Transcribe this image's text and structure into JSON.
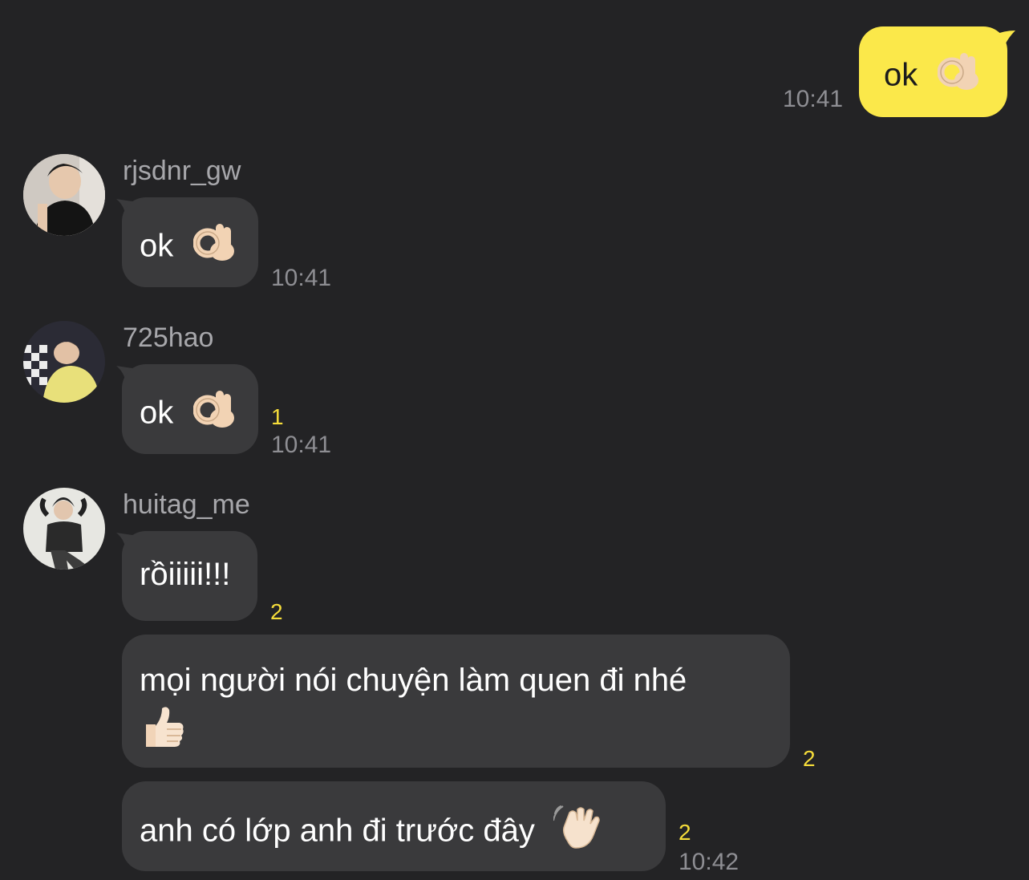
{
  "messages": [
    {
      "sender": "me",
      "text": "ok",
      "emoji": "ok-hand",
      "time": "10:41"
    },
    {
      "sender": "rjsdnr_gw",
      "text": "ok",
      "emoji": "ok-hand",
      "time": "10:41"
    },
    {
      "sender": "725hao",
      "text": "ok",
      "emoji": "ok-hand",
      "unread": "1",
      "time": "10:41"
    },
    {
      "sender": "huitag_me",
      "text": "rồiiiii!!!",
      "unread": "2"
    },
    {
      "sender": "huitag_me",
      "text": "mọi người nói chuyện làm quen đi nhé",
      "emoji": "thumbs-up",
      "unread": "2"
    },
    {
      "sender": "huitag_me",
      "text": "anh có lớp anh đi trước đây",
      "emoji": "waving-hand",
      "unread": "2",
      "time": "10:42"
    }
  ],
  "colors": {
    "background": "#232325",
    "my_bubble": "#fbe84a",
    "their_bubble": "#3a3a3c",
    "unread": "#f5dc3a",
    "timestamp": "#8e8e93"
  }
}
